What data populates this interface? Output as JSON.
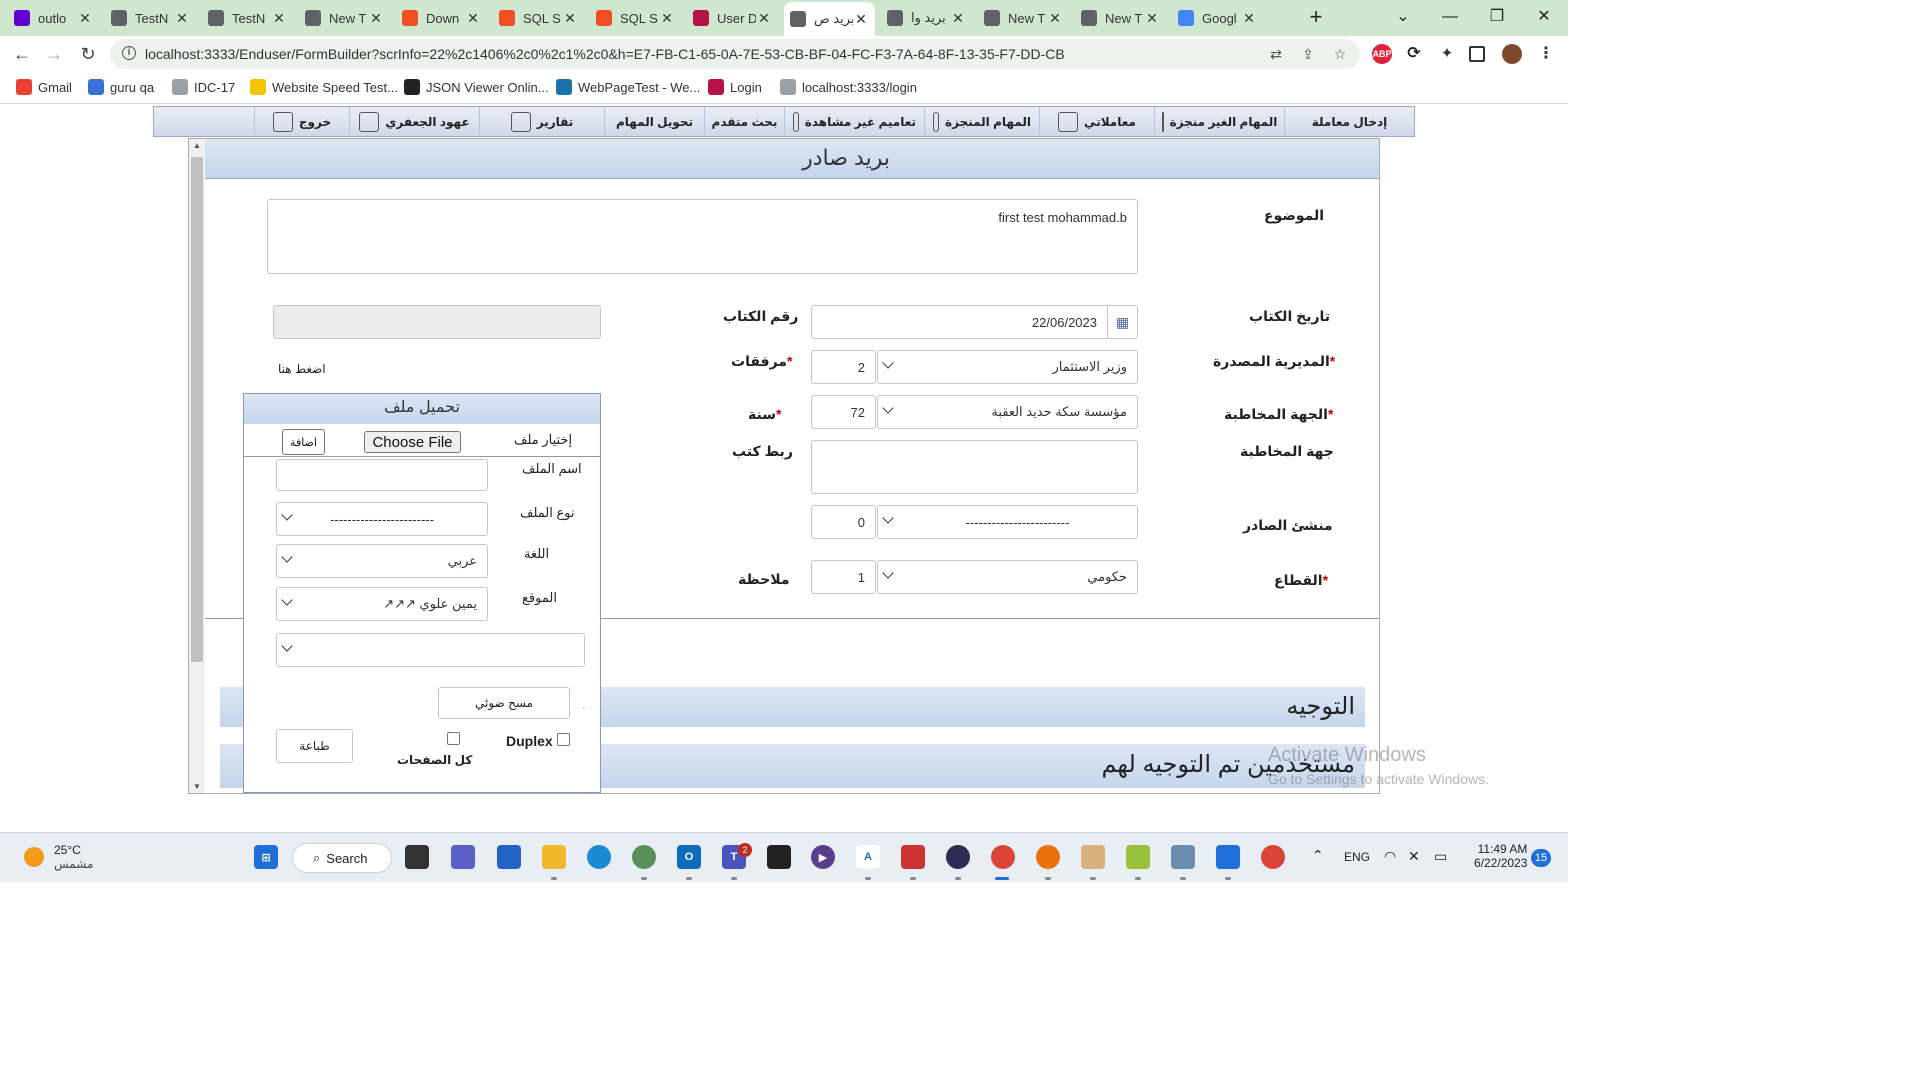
{
  "browser": {
    "tabs": [
      {
        "title": "outlo",
        "favicon": "yahoo-icon",
        "color": "#6001d2"
      },
      {
        "title": "TestN",
        "favicon": "globe-icon",
        "color": "#5f6368"
      },
      {
        "title": "TestN",
        "favicon": "globe-icon",
        "color": "#5f6368"
      },
      {
        "title": "New T",
        "favicon": "globe-icon",
        "color": "#5f6368"
      },
      {
        "title": "Down",
        "favicon": "microsoft-icon",
        "color": "#f25022"
      },
      {
        "title": "SQL S",
        "favicon": "microsoft-icon",
        "color": "#f25022"
      },
      {
        "title": "SQL S",
        "favicon": "microsoft-icon",
        "color": "#f25022"
      },
      {
        "title": "User D",
        "favicon": "app-icon",
        "color": "#b5124b"
      },
      {
        "title": "بريد ص",
        "favicon": "document-icon",
        "color": "#5f6368",
        "active": true
      },
      {
        "title": "بريد وا",
        "favicon": "document-icon",
        "color": "#5f6368"
      },
      {
        "title": "New T",
        "favicon": "globe-icon",
        "color": "#5f6368"
      },
      {
        "title": "New T",
        "favicon": "globe-icon",
        "color": "#5f6368"
      },
      {
        "title": "Googl",
        "favicon": "google-translate-icon",
        "color": "#4285f4"
      }
    ],
    "url": "localhost:3333/Enduser/FormBuilder?scrInfo=22%2c1406%2c0%2c1%2c0&h=E7-FB-C1-65-0A-7E-53-CB-BF-04-FC-F3-7A-64-8F-13-35-F7-DD-CB",
    "bookmarks": [
      {
        "label": "Gmail",
        "icon": "gmail-icon",
        "color": "#ea4335"
      },
      {
        "label": "guru qa",
        "icon": "guru-icon",
        "color": "#3b6fd8"
      },
      {
        "label": "IDC-17",
        "icon": "image-icon",
        "color": "#9aa0a6"
      },
      {
        "label": "Website Speed Test...",
        "icon": "speed-icon",
        "color": "#f5c400"
      },
      {
        "label": "JSON Viewer Onlin...",
        "icon": "json-icon",
        "color": "#222222"
      },
      {
        "label": "WebPageTest - We...",
        "icon": "webpagetest-icon",
        "color": "#1a73a8"
      },
      {
        "label": "Login",
        "icon": "login-icon",
        "color": "#b5124b"
      },
      {
        "label": "localhost:3333/login",
        "icon": "page-icon",
        "color": "#9aa0a6"
      }
    ]
  },
  "menu": {
    "items": [
      {
        "label": "إدخال معاملة",
        "icon": ""
      },
      {
        "label": "المهام الغير منجزة",
        "icon": "tasks-icon"
      },
      {
        "label": "معاملاتي",
        "icon": "transactions-icon"
      },
      {
        "label": "المهام المنجزة",
        "icon": "done-tasks-icon"
      },
      {
        "label": "تعاميم غير مشاهدة",
        "icon": "announcement-icon"
      },
      {
        "label": "بحث متقدم",
        "icon": ""
      },
      {
        "label": "تحويل المهام",
        "icon": ""
      },
      {
        "label": "تقارير",
        "icon": "reports-icon"
      },
      {
        "label": "عهود الجعفري",
        "icon": "user-icon"
      },
      {
        "label": "خروج",
        "icon": "logout-icon"
      }
    ]
  },
  "form": {
    "title": "بريد صادر",
    "subject_label": "الموضوع",
    "subject_value": "first test mohammad.b",
    "letter_date_label": "تاريخ الكتاب",
    "letter_date_value": "22/06/2023",
    "letter_number_label": "رقم الكتاب",
    "issuing_directorate_label": "المديرية المصدرة",
    "issuing_directorate_value": "وزير الاستثمار",
    "attachments_label": "مرفقات",
    "attachments_value": "2",
    "addressee_label": "الجهة المخاطبة",
    "addressee_value": "مؤسسة سكة حديد العقبة",
    "year_label": "سنة",
    "year_value": "72",
    "addressee_side_label": "جهة المخاطبة",
    "link_letters_label": "ربط كتب",
    "originator_label": "منشئ الصادر",
    "originator_value": "------------------------",
    "originator_count": "0",
    "sector_label": "القطاع",
    "sector_value": "حكومي",
    "sector_count": "1",
    "note_label": "ملاحظة",
    "click_here": "اضغط هنا",
    "required_mark": "*"
  },
  "upload": {
    "title": "تحميل ملف",
    "choose_label": "إختيار ملف",
    "choose_button": "Choose File",
    "add_button": "اضافة",
    "filename_label": "اسم الملف",
    "filetype_label": "نوع الملف",
    "filetype_value": "------------------------",
    "language_label": "اللغة",
    "language_value": "عربي",
    "position_label": "الموقع",
    "position_value": "يمين علوي ↗↗↗",
    "scan_button": "مسح ضوئي",
    "dot": ".",
    "duplex_label": "Duplex",
    "all_pages_label": "كل الصفحات",
    "print_button": "طباعة"
  },
  "sections": {
    "routing": "التوجيه",
    "routed_users": "مستخدمين تم التوجيه لهم"
  },
  "watermark": {
    "line1": "Activate Windows",
    "line2": "Go to Settings to activate Windows."
  },
  "taskbar": {
    "temperature": "25°C",
    "weather": "مشمس",
    "search": "Search",
    "lang": "ENG",
    "time": "11:49 AM",
    "date": "6/22/2023",
    "notifications": "15",
    "teams_badge": "2"
  }
}
